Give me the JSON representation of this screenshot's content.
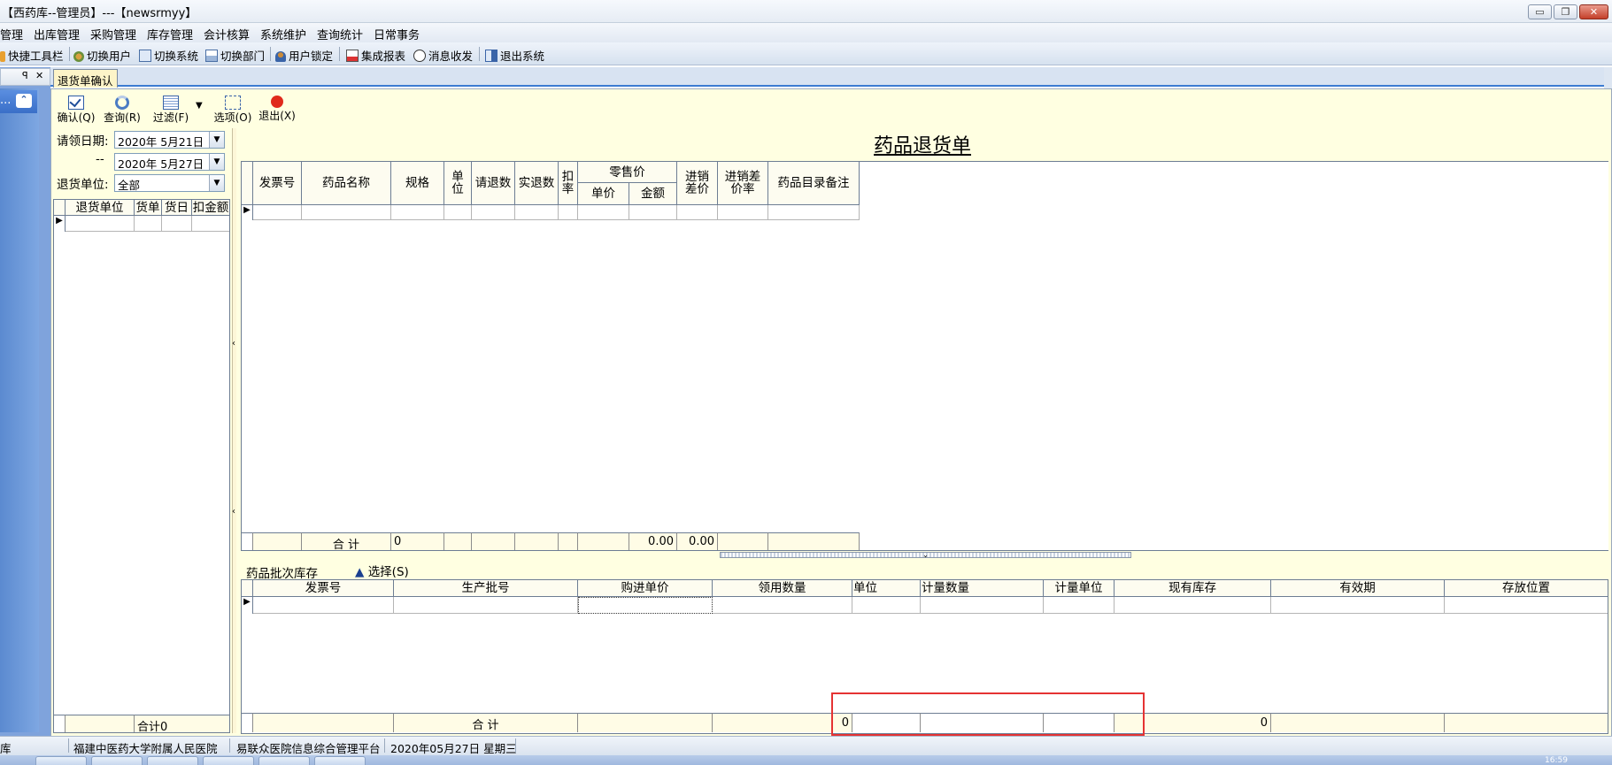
{
  "window": {
    "title": "【西药库--管理员】---【newsrmyy】",
    "buttons": [
      "▭",
      "❐",
      "✕"
    ]
  },
  "menu": {
    "items": [
      "管理",
      "出库管理",
      "采购管理",
      "库存管理",
      "会计核算",
      "系统维护",
      "查询统计",
      "日常事务"
    ]
  },
  "quickbar": {
    "items": [
      "快捷工具栏",
      "切换用户",
      "切换系统",
      "切换部门",
      "用户锁定",
      "集成报表",
      "消息收发",
      "退出系统"
    ]
  },
  "dock": {
    "pin": "ꟼ",
    "close": "✕",
    "dots": "...",
    "up": "⌃"
  },
  "tabs": [
    "退货单确认"
  ],
  "toolbar": {
    "confirm": "确认(Q)",
    "query": "查询(R)",
    "filter": "过滤(F)",
    "dropdown": "▼",
    "options": "选项(O)",
    "exit": "退出(X)"
  },
  "filters": {
    "date_label": "请领日期:",
    "date_from": "2020年 5月21日",
    "dash": "--",
    "date_to": "2020年 5月27日",
    "unit_label": "退货单位:",
    "unit_value": "全部"
  },
  "left_grid": {
    "headers": [
      "退货单位",
      "货单",
      "货日",
      "扣金额"
    ],
    "total_label": "合计",
    "total_value": "0"
  },
  "document": {
    "title": "药品退货单"
  },
  "main_grid": {
    "headers": [
      "发票号",
      "药品名称",
      "规格",
      "单\n位",
      "请退数",
      "实退数",
      "扣\n率",
      "零售价",
      "单价",
      "金额",
      "进销\n差价",
      "进销差\n价率",
      "药品目录备注"
    ],
    "total_label": "合  计",
    "total_qty": "0",
    "total_amount": "0.00",
    "total_diff": "0.00"
  },
  "batch": {
    "title": "药品批次库存",
    "select_label": "选择(S)",
    "headers": [
      "发票号",
      "生产批号",
      "购进单价",
      "领用数量",
      "单位",
      "计量数量",
      "计量单位",
      "现有库存",
      "有效期",
      "存放位置"
    ],
    "total_label": "合  计",
    "total_qty": "0",
    "total_stock": "0"
  },
  "status": {
    "items": [
      "库",
      "福建中医药大学附属人民医院",
      "易联众医院信息综合管理平台",
      "2020年05月27日  星期三"
    ],
    "clock": "16:59"
  }
}
